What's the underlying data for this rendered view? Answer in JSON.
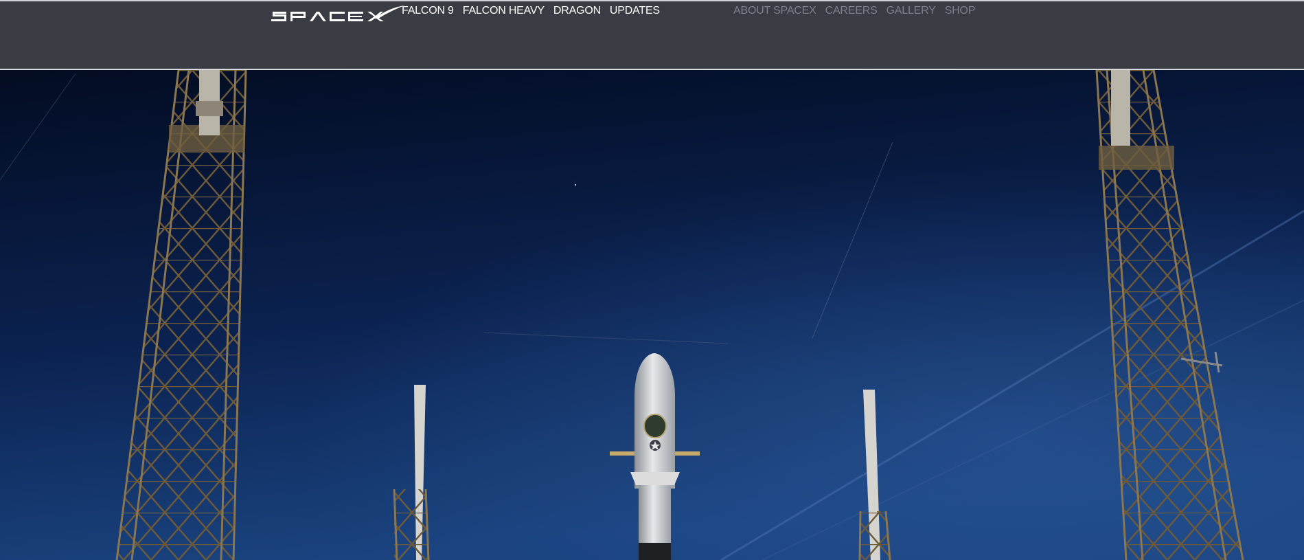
{
  "header": {
    "logo_text": "SPACEX",
    "primary_nav": [
      {
        "label": "FALCON 9"
      },
      {
        "label": "FALCON HEAVY"
      },
      {
        "label": "DRAGON"
      },
      {
        "label": "UPDATES"
      }
    ],
    "secondary_nav": [
      {
        "label": "ABOUT SPACEX"
      },
      {
        "label": "CAREERS"
      },
      {
        "label": "GALLERY"
      },
      {
        "label": "SHOP"
      }
    ]
  },
  "hero": {
    "image_subject": "falcon-9-on-launch-pad-at-night",
    "prev_icon": "chevron-left-icon",
    "next_icon": "chevron-right-icon"
  },
  "colors": {
    "navbar_bg": "#393c42",
    "primary_link": "#ffffff",
    "secondary_link": "#7b8089",
    "sky_top": "#04102a",
    "sky_bottom": "#163a78"
  }
}
